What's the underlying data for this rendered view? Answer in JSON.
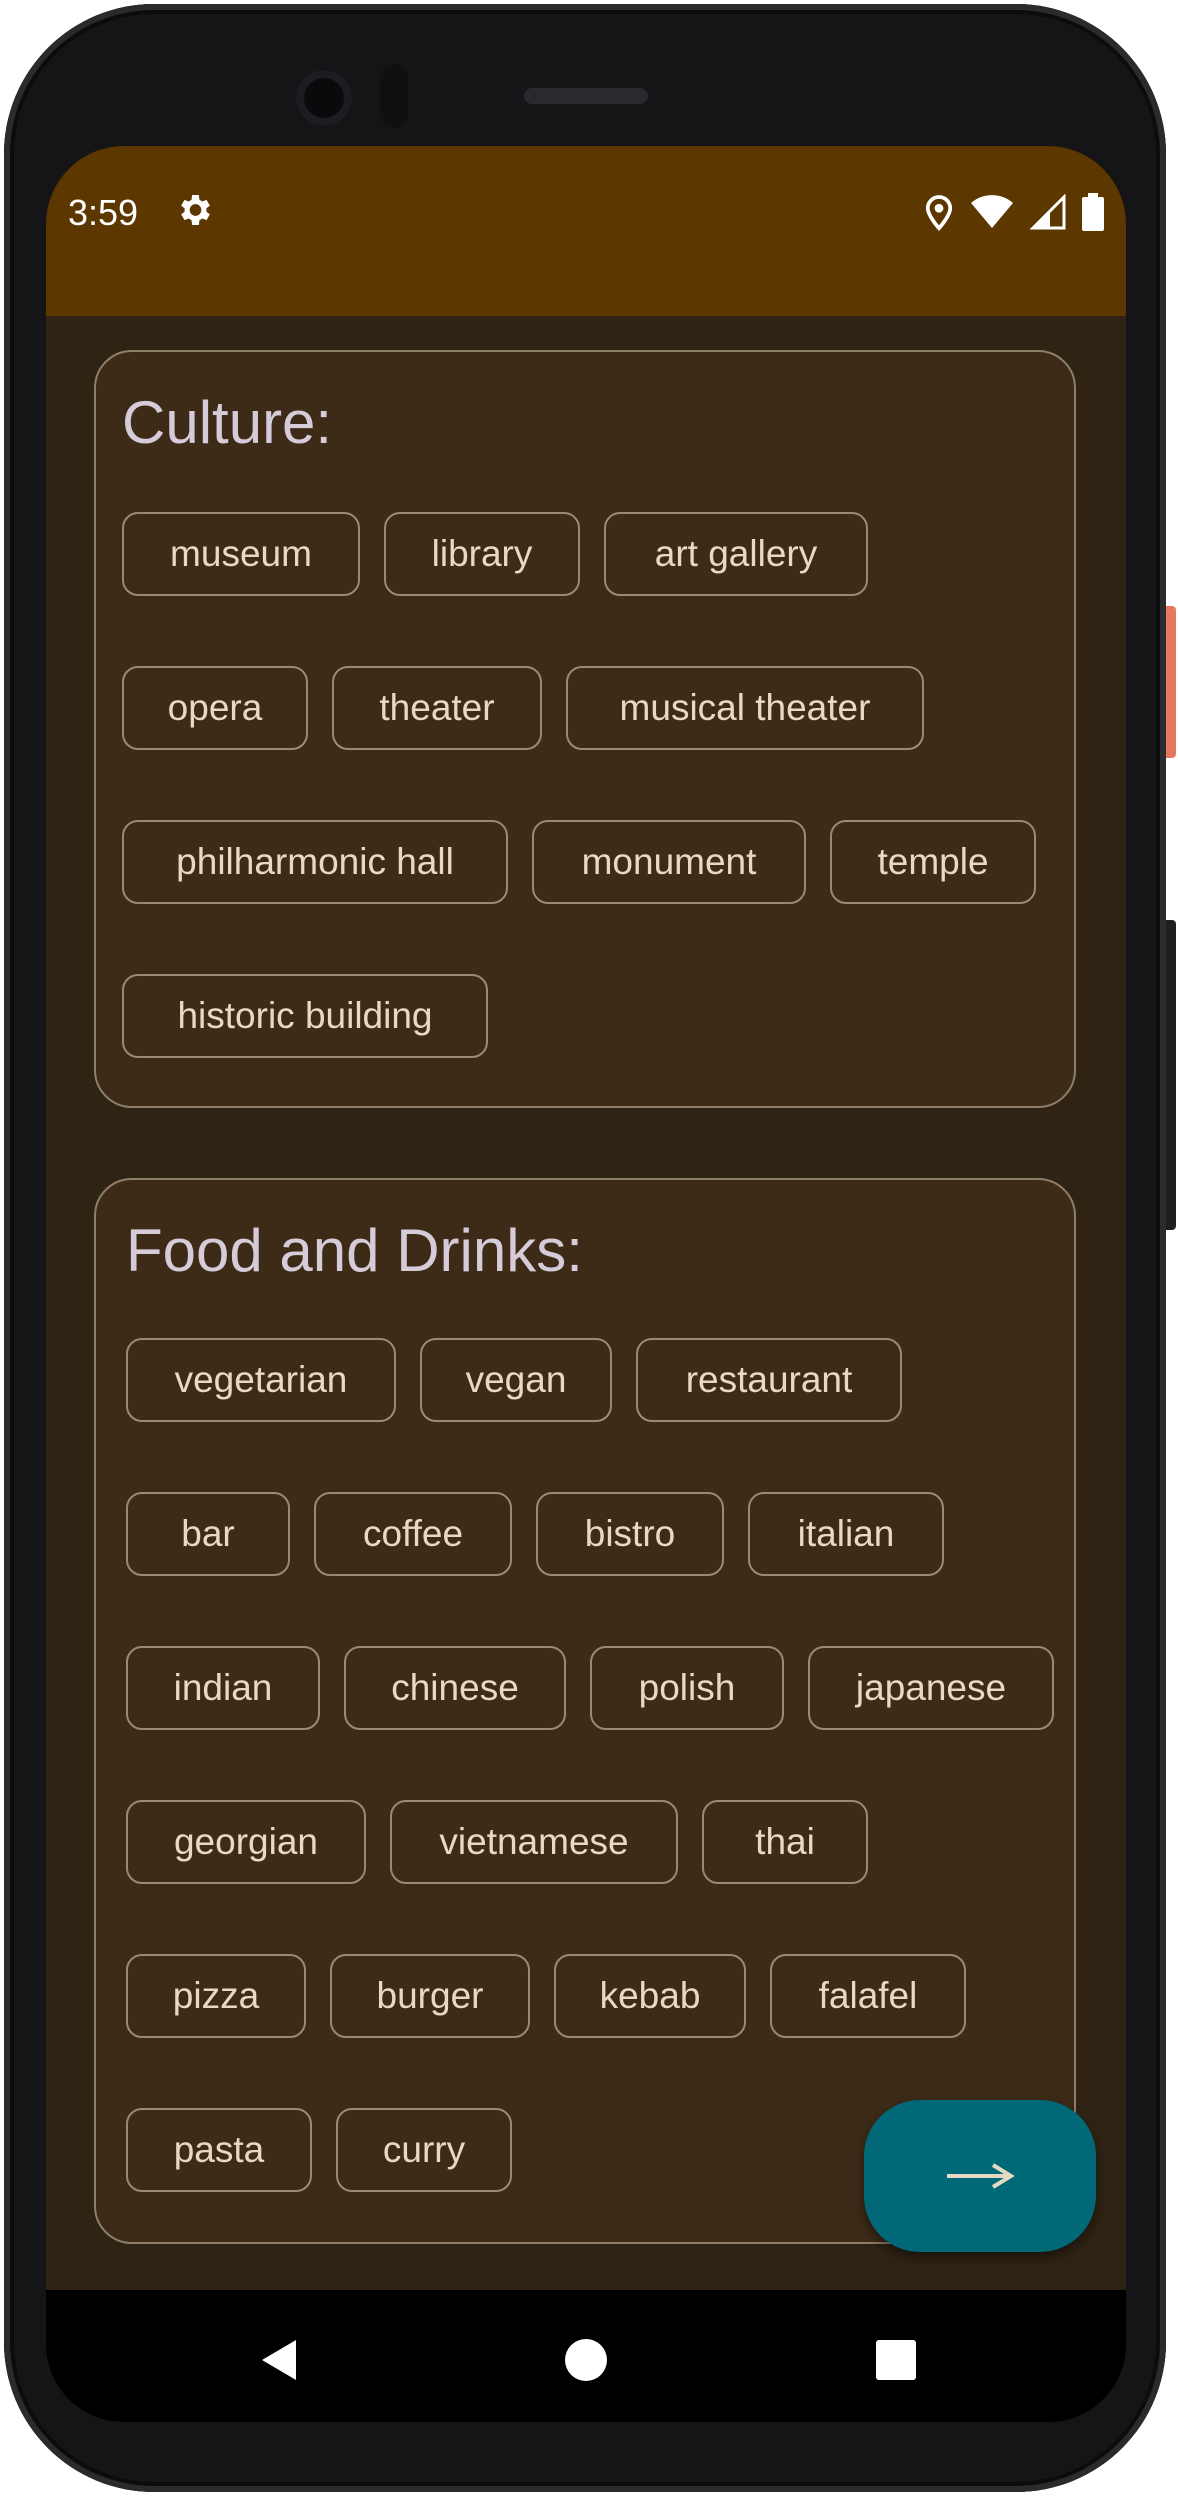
{
  "status_bar": {
    "time": "3:59",
    "icons": [
      "gear-icon",
      "location-icon",
      "wifi-icon",
      "signal-icon",
      "battery-icon"
    ],
    "background": "#5c3700"
  },
  "sections": [
    {
      "title": "Culture:",
      "chips": [
        "museum",
        "library",
        "art gallery",
        "opera",
        "theater",
        "musical theater",
        "philharmonic hall",
        "monument",
        "temple",
        "historic building"
      ]
    },
    {
      "title": "Food and Drinks:",
      "chips": [
        "vegetarian",
        "vegan",
        "restaurant",
        "bar",
        "coffee",
        "bistro",
        "italian",
        "indian",
        "chinese",
        "polish",
        "japanese",
        "georgian",
        "vietnamese",
        "thai",
        "pizza",
        "burger",
        "kebab",
        "falafel",
        "pasta",
        "curry"
      ]
    }
  ],
  "fab": {
    "icon": "arrow-right-icon",
    "color": "#006876"
  },
  "navigation": {
    "icons": [
      "back-icon",
      "home-icon",
      "recents-icon"
    ]
  }
}
